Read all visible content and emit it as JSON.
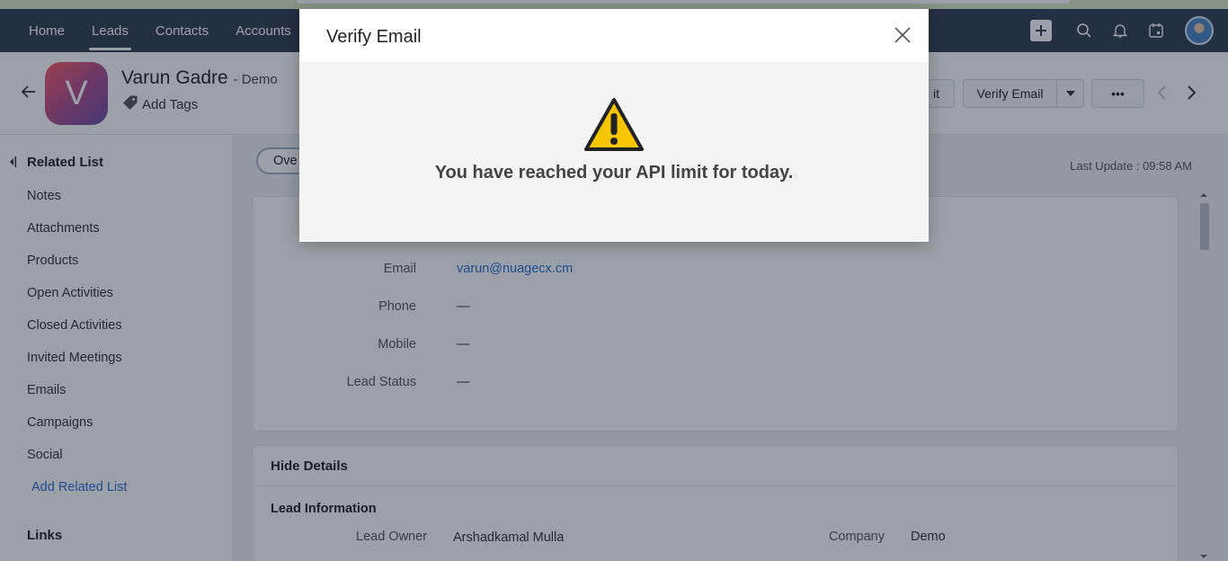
{
  "nav": {
    "tabs": [
      {
        "label": "Home"
      },
      {
        "label": "Leads",
        "active": true
      },
      {
        "label": "Contacts"
      },
      {
        "label": "Accounts"
      }
    ],
    "icons": [
      "plus-icon",
      "search-icon",
      "bell-icon",
      "calendar-icon",
      "user-avatar"
    ]
  },
  "lead": {
    "initial": "V",
    "name": "Varun Gadre",
    "company_suffix": "- Demo",
    "add_tags": "Add Tags"
  },
  "header_buttons": {
    "edit_label": "it",
    "verify_label": "Verify Email",
    "more_label": "•••"
  },
  "sidebar": {
    "title": "Related List",
    "items": [
      "Notes",
      "Attachments",
      "Products",
      "Open Activities",
      "Closed Activities",
      "Invited Meetings",
      "Emails",
      "Campaigns",
      "Social"
    ],
    "add_link": "Add Related List",
    "links_title": "Links"
  },
  "content": {
    "overview_tab": "Ove",
    "last_update": "Last Update : 09:58 AM",
    "fields": [
      {
        "label": "Email",
        "value": "varun@nuagecx.cm"
      },
      {
        "label": "Phone",
        "value": "—"
      },
      {
        "label": "Mobile",
        "value": "—"
      },
      {
        "label": "Lead Status",
        "value": "—"
      }
    ],
    "details": {
      "hide_details": "Hide Details",
      "section": "Lead Information",
      "lead_owner_label": "Lead Owner",
      "lead_owner_value": "Arshadkamal Mulla",
      "company_label": "Company",
      "company_value": "Demo"
    }
  },
  "modal": {
    "title": "Verify Email",
    "message": "You have reached your API limit for today.",
    "warning_color": "#f7c600"
  },
  "colors": {
    "navbar": "#2f3b4f",
    "link": "#2a6dd1",
    "topstrip": "#d9e8c2"
  }
}
